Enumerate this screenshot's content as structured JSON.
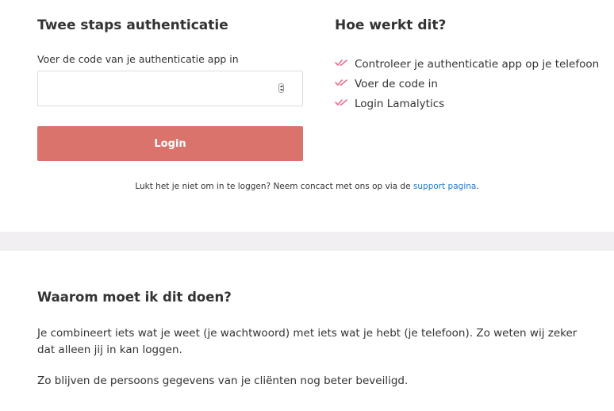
{
  "login": {
    "title": "Twee staps authenticatie",
    "code_label": "Voer de code van je authenticatie app in",
    "code_value": "",
    "button_label": "Login",
    "button_color": "#d9736c"
  },
  "help": {
    "title": "Hoe werkt dit?",
    "steps": [
      "Controleer je authenticatie app op je telefoon",
      "Voer de code in",
      "Login Lamalytics"
    ],
    "check_icon_color": "#e7708a"
  },
  "support": {
    "text": "Lukt het je niet om in te loggen? Neem concact met ons op via de",
    "link_label": "support pagina",
    "suffix": ".",
    "link_color": "#1d7bd3"
  },
  "why": {
    "title": "Waarom moet ik dit doen?",
    "paragraph1": "Je combineert iets wat je weet (je wachtwoord) met iets wat je hebt (je telefoon). Zo weten wij zeker dat alleen jij in kan loggen.",
    "paragraph2": "Zo blijven de persoons gegevens van je cliënten nog beter beveiligd."
  }
}
